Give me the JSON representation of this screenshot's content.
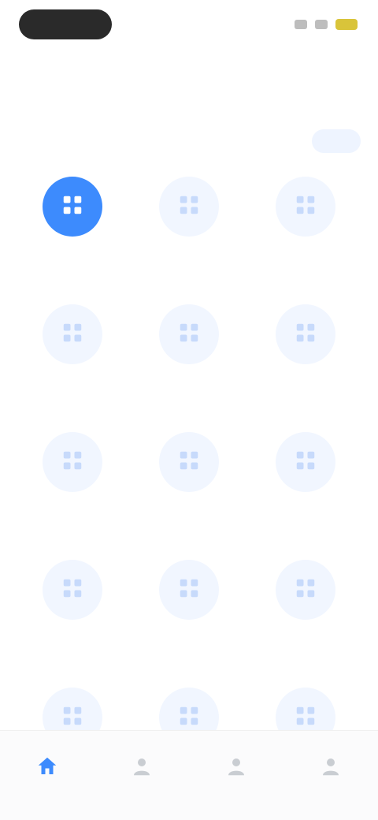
{
  "status_bar": {
    "time": "",
    "signal_icon": "signal-icon",
    "battery_icon": "battery-icon"
  },
  "header": {
    "subtitle": "",
    "caption": "",
    "title": "",
    "see_all_label": ""
  },
  "grid": {
    "items": [
      {
        "label": "",
        "icon": "grid-icon",
        "active": true
      },
      {
        "label": "",
        "icon": "grid-icon",
        "active": false
      },
      {
        "label": "",
        "icon": "grid-icon",
        "active": false
      },
      {
        "label": "",
        "icon": "grid-icon",
        "active": false
      },
      {
        "label": "",
        "icon": "grid-icon",
        "active": false
      },
      {
        "label": "",
        "icon": "grid-icon",
        "active": false
      },
      {
        "label": "",
        "icon": "grid-icon",
        "active": false
      },
      {
        "label": "",
        "icon": "grid-icon",
        "active": false
      },
      {
        "label": "",
        "icon": "grid-icon",
        "active": false
      },
      {
        "label": "",
        "icon": "grid-icon",
        "active": false
      },
      {
        "label": "",
        "icon": "grid-icon",
        "active": false
      },
      {
        "label": "",
        "icon": "grid-icon",
        "active": false
      },
      {
        "label": "",
        "icon": "grid-icon",
        "active": false
      },
      {
        "label": "",
        "icon": "grid-icon",
        "active": false
      },
      {
        "label": "",
        "icon": "grid-icon",
        "active": false
      }
    ]
  },
  "bottom_nav": {
    "items": [
      {
        "label": "",
        "icon": "home-icon",
        "active": true
      },
      {
        "label": "",
        "icon": "person-icon",
        "active": false
      },
      {
        "label": "",
        "icon": "person-icon",
        "active": false
      },
      {
        "label": "",
        "icon": "person-icon",
        "active": false
      }
    ]
  },
  "colors": {
    "accent": "#3d8bfd",
    "icon_bg": "#f1f6ff",
    "muted_text": "#8a8f96"
  }
}
